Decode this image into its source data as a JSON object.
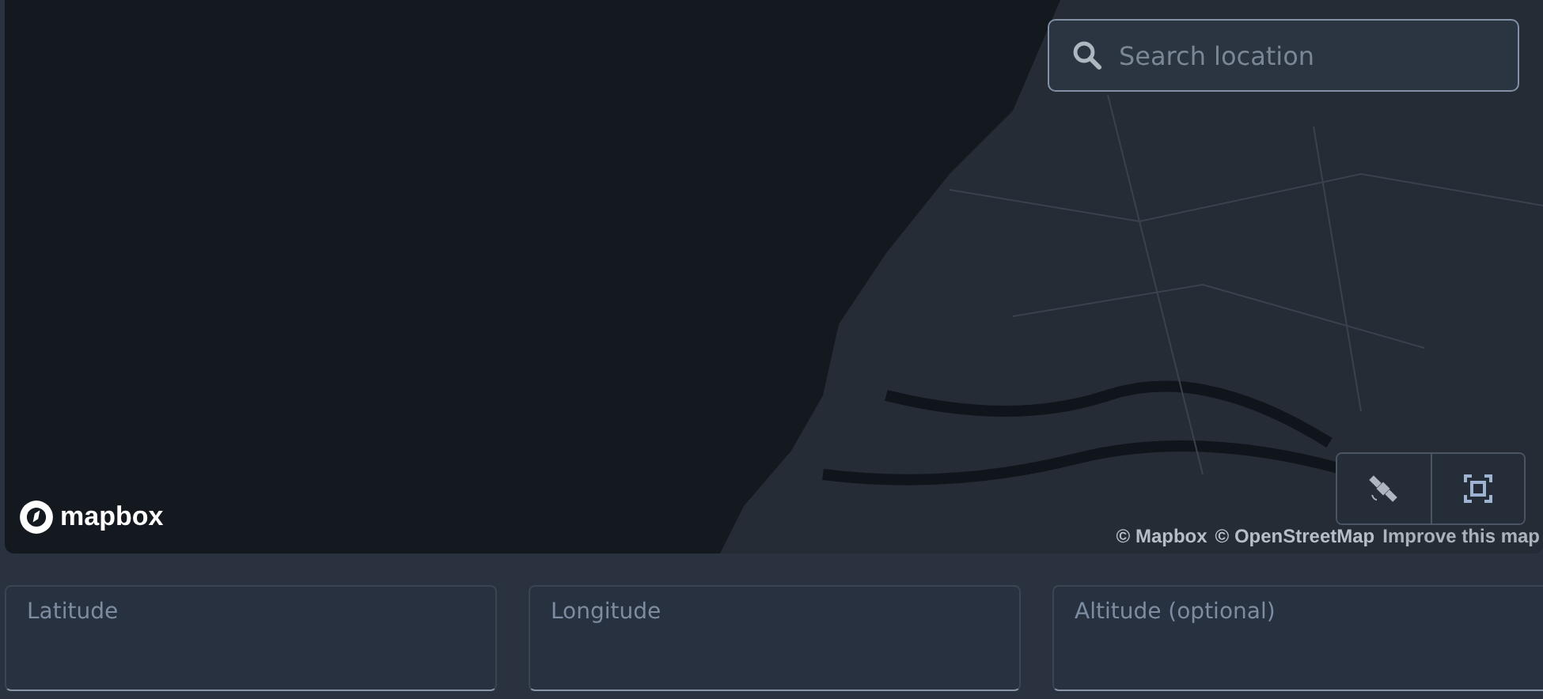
{
  "map": {
    "search": {
      "placeholder": "Search location"
    },
    "logo": {
      "text": "mapbox"
    },
    "attribution": [
      {
        "text": "© Mapbox"
      },
      {
        "text": "© OpenStreetMap"
      },
      {
        "text": "Improve this map",
        "kind": "strong"
      }
    ],
    "controls": [
      {
        "kind": "satellite"
      },
      {
        "kind": "fullscreen"
      }
    ]
  },
  "fields": [
    {
      "label": "Latitude"
    },
    {
      "label": "Longitude"
    },
    {
      "label": "Altitude (optional)"
    }
  ]
}
